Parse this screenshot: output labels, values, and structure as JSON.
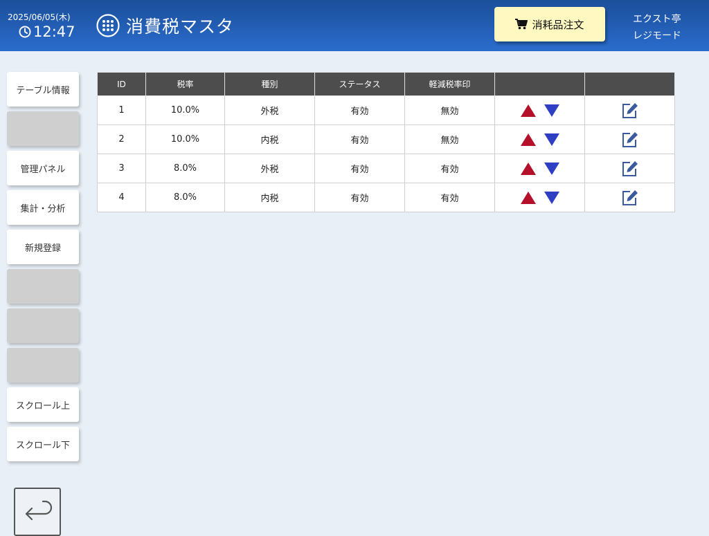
{
  "header": {
    "date": "2025/06/05(木)",
    "time": "12:47",
    "title": "消費税マスタ",
    "order_label": "消耗品注文",
    "shop": "エクスト亭",
    "mode": "レジモード"
  },
  "sidebar": {
    "items": [
      {
        "label": "テーブル情報"
      },
      {
        "label": ""
      },
      {
        "label": "管理パネル"
      },
      {
        "label": "集計・分析"
      },
      {
        "label": "新規登録"
      },
      {
        "label": ""
      },
      {
        "label": ""
      },
      {
        "label": ""
      },
      {
        "label": "スクロール上"
      },
      {
        "label": "スクロール下"
      }
    ]
  },
  "table": {
    "headers": [
      "ID",
      "税率",
      "種別",
      "ステータス",
      "軽減税率印",
      "",
      ""
    ],
    "rows": [
      {
        "id": "1",
        "rate": "10.0%",
        "type": "外税",
        "status": "有効",
        "reduced": "無効"
      },
      {
        "id": "2",
        "rate": "10.0%",
        "type": "内税",
        "status": "有効",
        "reduced": "無効"
      },
      {
        "id": "3",
        "rate": "8.0%",
        "type": "外税",
        "status": "有効",
        "reduced": "有効"
      },
      {
        "id": "4",
        "rate": "8.0%",
        "type": "内税",
        "status": "有効",
        "reduced": "有効"
      }
    ]
  },
  "colors": {
    "header_bg": "#2a6ccd",
    "order_button": "#fff8c0",
    "up_arrow": "#b5102a",
    "down_arrow": "#2f3fc4",
    "edit_icon": "#3a5aa0"
  }
}
